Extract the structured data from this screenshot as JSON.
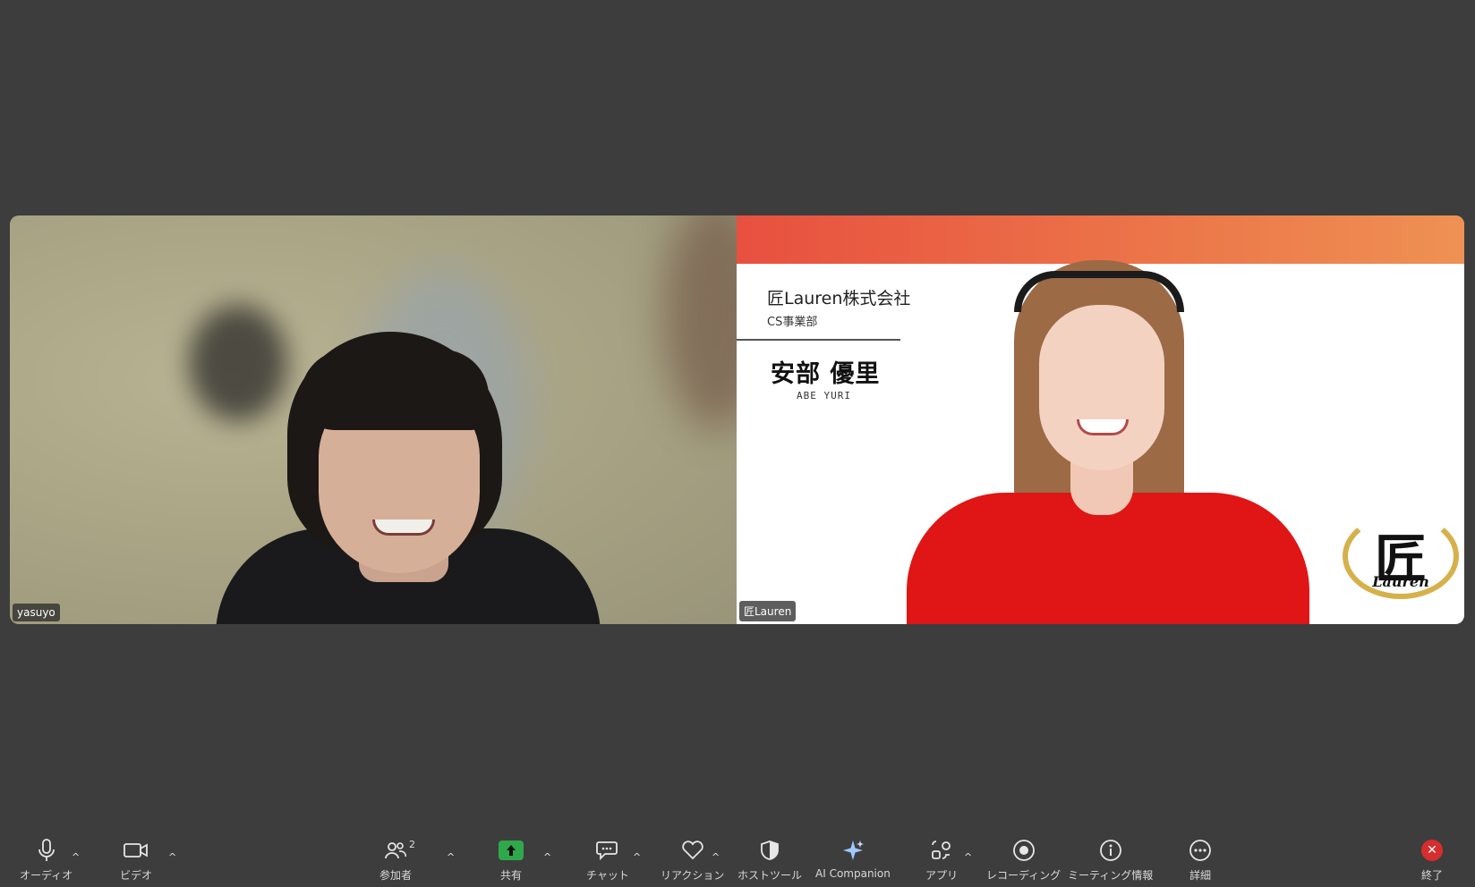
{
  "participants": [
    {
      "name": "yasuyo"
    },
    {
      "name": "匠Lauren"
    }
  ],
  "background_card": {
    "company": "匠Lauren株式会社",
    "department": "CS事業部",
    "person_name_jp": "安部 優里",
    "person_name_en": "ABE YURI",
    "logo_kanji": "匠",
    "logo_text": "Lauren",
    "banner_color_start": "#e8503f",
    "banner_color_end": "#ef9154"
  },
  "toolbar": {
    "audio": {
      "label": "オーディオ",
      "icon": "microphone-icon"
    },
    "video": {
      "label": "ビデオ",
      "icon": "camera-icon"
    },
    "participants": {
      "label": "参加者",
      "count": "2",
      "icon": "people-icon"
    },
    "share": {
      "label": "共有",
      "icon": "share-arrow-icon",
      "color": "#2ea84a"
    },
    "chat": {
      "label": "チャット",
      "icon": "chat-bubble-icon"
    },
    "reactions": {
      "label": "リアクション",
      "icon": "heart-icon"
    },
    "host_tools": {
      "label": "ホストツール",
      "icon": "shield-icon"
    },
    "ai_companion": {
      "label": "AI Companion",
      "icon": "sparkle-icon"
    },
    "apps": {
      "label": "アプリ",
      "icon": "apps-icon"
    },
    "recording": {
      "label": "レコーディング",
      "icon": "record-icon"
    },
    "meeting_info": {
      "label": "ミーティング情報",
      "icon": "info-icon"
    },
    "more": {
      "label": "詳細",
      "icon": "more-dots-icon"
    },
    "end": {
      "label": "終了",
      "icon": "close-icon",
      "color": "#d62d2d"
    },
    "caret": "^"
  }
}
